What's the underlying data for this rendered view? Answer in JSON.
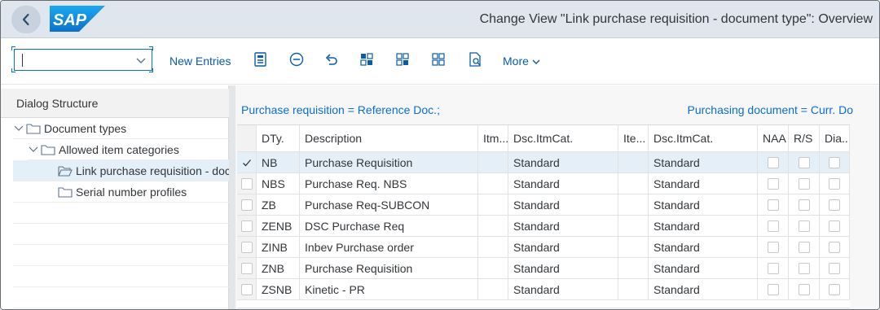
{
  "header": {
    "logo_text": "SAP",
    "title": "Change View \"Link purchase requisition - document type\": Overview"
  },
  "toolbar": {
    "command_value": "",
    "new_entries_label": "New Entries",
    "more_label": "More",
    "icons": [
      "details-icon",
      "remove-icon",
      "undo-icon",
      "select-all-icon",
      "select-block-icon",
      "deselect-all-icon",
      "print-preview-icon"
    ]
  },
  "dialog": {
    "title": "Dialog Structure",
    "items": [
      {
        "label": "Document types",
        "icon": "folder-icon"
      },
      {
        "label": "Allowed item categories",
        "icon": "folder-icon"
      },
      {
        "label": "Link purchase requisition - document type",
        "icon": "folder-open-icon"
      },
      {
        "label": "Serial number profiles",
        "icon": "folder-icon"
      }
    ]
  },
  "main": {
    "left_header": "Purchase requisition = Reference Doc.;",
    "right_header": "Purchasing document = Curr. Do",
    "columns": [
      "DTy.",
      "Description",
      "Itm...",
      "Dsc.ItmCat.",
      "Ite...",
      "Dsc.ItmCat.",
      "NAA",
      "R/S",
      "Dia..."
    ],
    "rows": [
      {
        "dty": "NB",
        "description": "Purchase Requisition",
        "itm": "",
        "dsc1": "Standard",
        "ite": "",
        "dsc2": "Standard",
        "selected": true
      },
      {
        "dty": "NBS",
        "description": "Purchase Req. NBS",
        "itm": "",
        "dsc1": "Standard",
        "ite": "",
        "dsc2": "Standard",
        "selected": false
      },
      {
        "dty": "ZB",
        "description": "Purchase Req-SUBCON",
        "itm": "",
        "dsc1": "Standard",
        "ite": "",
        "dsc2": "Standard",
        "selected": false
      },
      {
        "dty": "ZENB",
        "description": "DSC Purchase Req",
        "itm": "",
        "dsc1": "Standard",
        "ite": "",
        "dsc2": "Standard",
        "selected": false
      },
      {
        "dty": "ZINB",
        "description": "Inbev Purchase order",
        "itm": "",
        "dsc1": "Standard",
        "ite": "",
        "dsc2": "Standard",
        "selected": false
      },
      {
        "dty": "ZNB",
        "description": "Purchase Requisition",
        "itm": "",
        "dsc1": "Standard",
        "ite": "",
        "dsc2": "Standard",
        "selected": false
      },
      {
        "dty": "ZSNB",
        "description": "Kinetic - PR",
        "itm": "",
        "dsc1": "Standard",
        "ite": "",
        "dsc2": "Standard",
        "selected": false
      }
    ]
  },
  "colors": {
    "header_bg": "#dfe6ee",
    "accent": "#0a6ed1",
    "selected_row": "#e5eff8"
  }
}
